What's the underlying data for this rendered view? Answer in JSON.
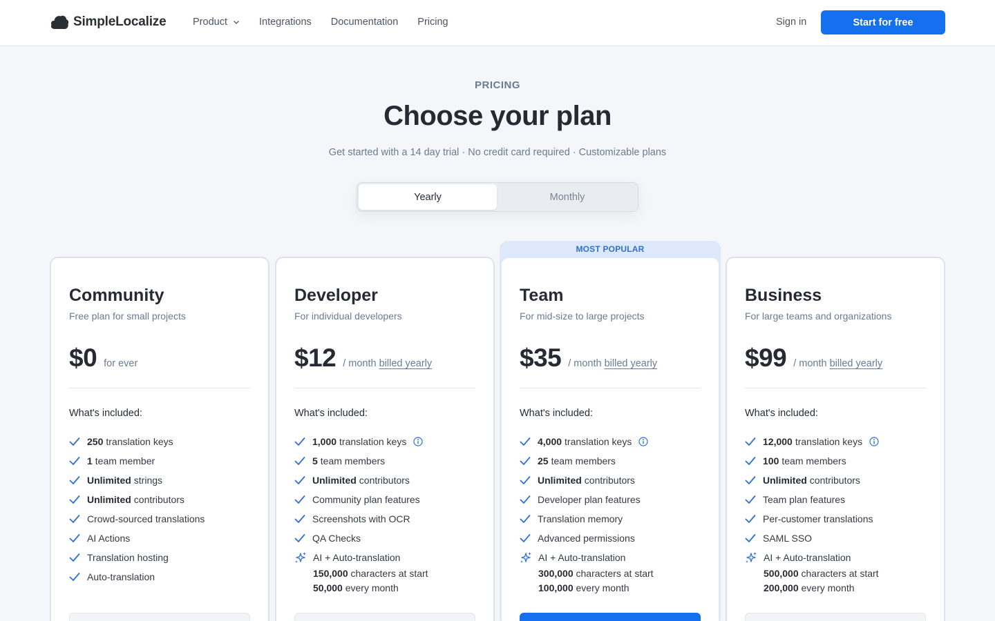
{
  "header": {
    "brand": "SimpleLocalize",
    "nav": [
      {
        "label": "Product",
        "has_dropdown": true
      },
      {
        "label": "Integrations"
      },
      {
        "label": "Documentation"
      },
      {
        "label": "Pricing"
      }
    ],
    "sign_in": "Sign in",
    "cta": "Start for free"
  },
  "hero": {
    "eyebrow": "PRICING",
    "title": "Choose your plan",
    "subtitle": "Get started with a 14 day trial · No credit card required · Customizable plans"
  },
  "billing_toggle": {
    "options": [
      "Yearly",
      "Monthly"
    ],
    "selected": "Yearly"
  },
  "popular_label": "MOST POPULAR",
  "included_label": "What's included:",
  "colors": {
    "accent": "#1570ef",
    "check": "#2f6fd6",
    "popular_band": "#dde9fb",
    "background": "#f4f6f9"
  },
  "plans": [
    {
      "name": "Community",
      "description": "Free plan for small projects",
      "price": "$0",
      "suffix": "for ever",
      "billed": "",
      "features": [
        {
          "bold": "250",
          "text": "translation keys"
        },
        {
          "bold": "1",
          "text": "team member"
        },
        {
          "bold": "Unlimited",
          "text": "strings"
        },
        {
          "bold": "Unlimited",
          "text": "contributors"
        },
        {
          "bold": "",
          "text": "Crowd-sourced translations"
        },
        {
          "bold": "",
          "text": "AI Actions"
        },
        {
          "bold": "",
          "text": "Translation hosting"
        },
        {
          "bold": "",
          "text": "Auto-translation"
        }
      ]
    },
    {
      "name": "Developer",
      "description": "For individual developers",
      "price": "$12",
      "suffix": "/ month",
      "billed": "billed yearly",
      "features": [
        {
          "bold": "1,000",
          "text": "translation keys",
          "info": true
        },
        {
          "bold": "5",
          "text": "team members"
        },
        {
          "bold": "Unlimited",
          "text": "contributors"
        },
        {
          "bold": "",
          "text": "Community plan features"
        },
        {
          "bold": "",
          "text": "Screenshots with OCR"
        },
        {
          "bold": "",
          "text": "QA Checks"
        }
      ],
      "ai": {
        "label": "AI + Auto-translation",
        "start_bold": "150,000",
        "start_text": "characters at start",
        "monthly_bold": "50,000",
        "monthly_text": "every month"
      }
    },
    {
      "name": "Team",
      "description": "For mid-size to large projects",
      "price": "$35",
      "suffix": "/ month",
      "billed": "billed yearly",
      "features": [
        {
          "bold": "4,000",
          "text": "translation keys",
          "info": true
        },
        {
          "bold": "25",
          "text": "team members"
        },
        {
          "bold": "Unlimited",
          "text": "contributors"
        },
        {
          "bold": "",
          "text": "Developer plan features"
        },
        {
          "bold": "",
          "text": "Translation memory"
        },
        {
          "bold": "",
          "text": "Advanced permissions"
        }
      ],
      "ai": {
        "label": "AI + Auto-translation",
        "start_bold": "300,000",
        "start_text": "characters at start",
        "monthly_bold": "100,000",
        "monthly_text": "every month"
      }
    },
    {
      "name": "Business",
      "description": "For large teams and organizations",
      "price": "$99",
      "suffix": "/ month",
      "billed": "billed yearly",
      "features": [
        {
          "bold": "12,000",
          "text": "translation keys",
          "info": true
        },
        {
          "bold": "100",
          "text": "team members"
        },
        {
          "bold": "Unlimited",
          "text": "contributors"
        },
        {
          "bold": "",
          "text": "Team plan features"
        },
        {
          "bold": "",
          "text": "Per-customer translations"
        },
        {
          "bold": "",
          "text": "SAML SSO"
        }
      ],
      "ai": {
        "label": "AI + Auto-translation",
        "start_bold": "500,000",
        "start_text": "characters at start",
        "monthly_bold": "200,000",
        "monthly_text": "every month"
      }
    }
  ]
}
